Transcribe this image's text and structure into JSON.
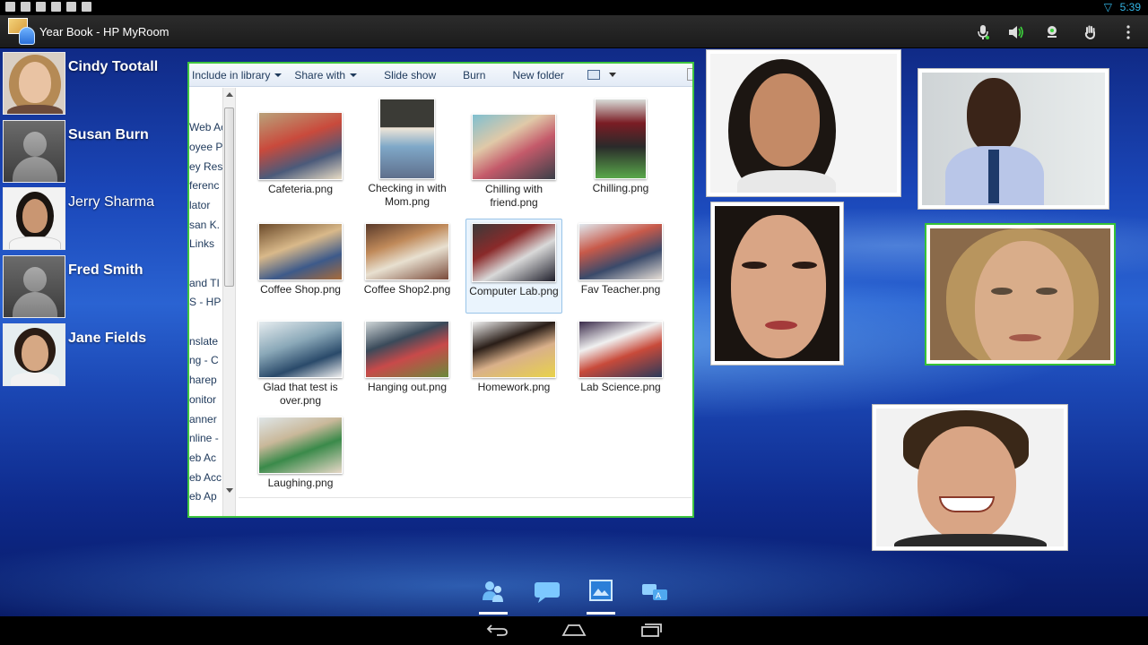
{
  "status_bar": {
    "time": "5:39"
  },
  "app_bar": {
    "title": "Year Book - HP MyRoom",
    "icons": [
      "microphone-icon",
      "speaker-icon",
      "webcam-icon",
      "raise-hand-icon",
      "overflow-menu-icon"
    ]
  },
  "roster": [
    {
      "name": "Cindy Tootall",
      "avatar": "photo"
    },
    {
      "name": "Susan Burn",
      "avatar": "generic"
    },
    {
      "name": "Jerry Sharma",
      "avatar": "photo"
    },
    {
      "name": "Fred Smith",
      "avatar": "generic"
    },
    {
      "name": "Jane Fields",
      "avatar": "photo"
    }
  ],
  "explorer": {
    "toolbar": {
      "include": "Include in library",
      "share": "Share with",
      "slideshow": "Slide show",
      "burn": "Burn",
      "newfolder": "New folder"
    },
    "nav_items": [
      "Web Ac",
      "oyee P",
      "ey Res",
      "ferenc",
      "lator",
      "san K.",
      " Links",
      "",
      "and TI",
      "S -  HP",
      "nslate",
      "ng - C",
      "harep",
      "onitor",
      "anner",
      "nline -",
      "eb Ac",
      "eb Acc",
      "eb Ap"
    ],
    "files": [
      {
        "name": "Cafeteria.png",
        "selected": false
      },
      {
        "name": "Checking in with Mom.png",
        "selected": false
      },
      {
        "name": "Chilling with friend.png",
        "selected": false
      },
      {
        "name": "Chilling.png",
        "selected": false
      },
      {
        "name": "Coffee Shop.png",
        "selected": false
      },
      {
        "name": "Coffee Shop2.png",
        "selected": false
      },
      {
        "name": "Computer Lab.png",
        "selected": true
      },
      {
        "name": "Fav Teacher.png",
        "selected": false
      },
      {
        "name": "Glad that test is over.png",
        "selected": false
      },
      {
        "name": "Hanging out.png",
        "selected": false
      },
      {
        "name": "Homework.png",
        "selected": false
      },
      {
        "name": "Lab Science.png",
        "selected": false
      },
      {
        "name": "Laughing.png",
        "selected": false
      }
    ]
  },
  "video_tiles": [
    {
      "id": "tile-1",
      "active": false
    },
    {
      "id": "tile-2",
      "active": false
    },
    {
      "id": "tile-3",
      "active": false
    },
    {
      "id": "tile-4",
      "active": true
    },
    {
      "id": "tile-5",
      "active": false
    }
  ],
  "taskbar": [
    "participants-icon",
    "chat-icon",
    "shared-content-icon",
    "translate-icon"
  ],
  "nav_bar": [
    "back-icon",
    "home-icon",
    "recent-apps-icon"
  ]
}
